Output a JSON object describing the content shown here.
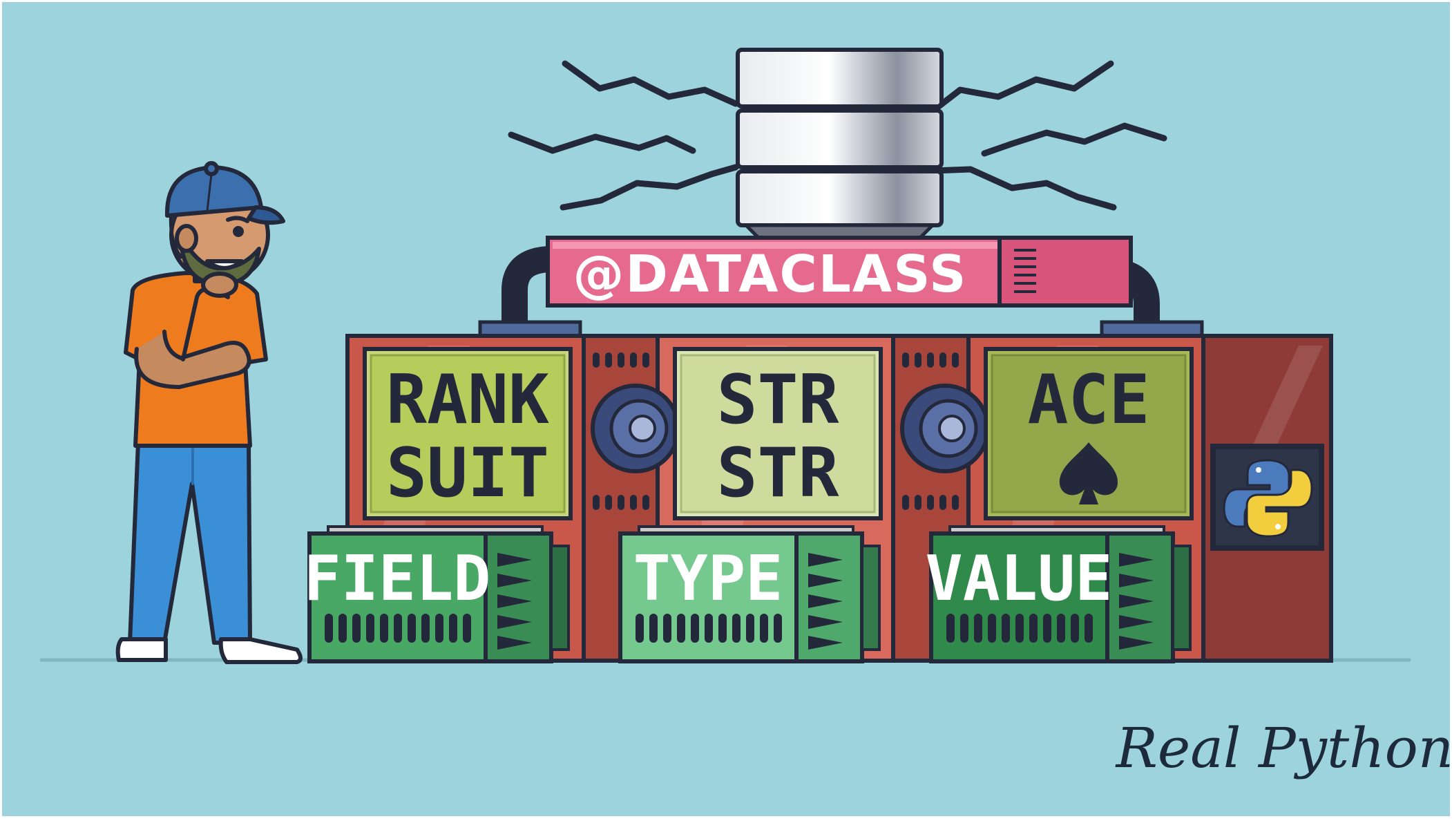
{
  "banner": {
    "text": "@DATACLASS"
  },
  "modules": [
    {
      "screen_line1": "RANK",
      "screen_line2": "SUIT",
      "label": "FIELD"
    },
    {
      "screen_line1": "STR",
      "screen_line2": "STR",
      "label": "TYPE"
    },
    {
      "screen_line1": "ACE",
      "screen_line2": "",
      "label": "VALUE"
    }
  ],
  "brand": {
    "logo_text": "Real Python"
  },
  "icons": [
    "database-icon",
    "spade-icon",
    "python-logo-icon"
  ],
  "colors": {
    "background": "#9dd3dc",
    "cabinet": "#c9574a",
    "screen": "#b6cd5c",
    "label_panel": "#4aa866",
    "banner": "#e66a8e",
    "outline": "#23283a"
  }
}
